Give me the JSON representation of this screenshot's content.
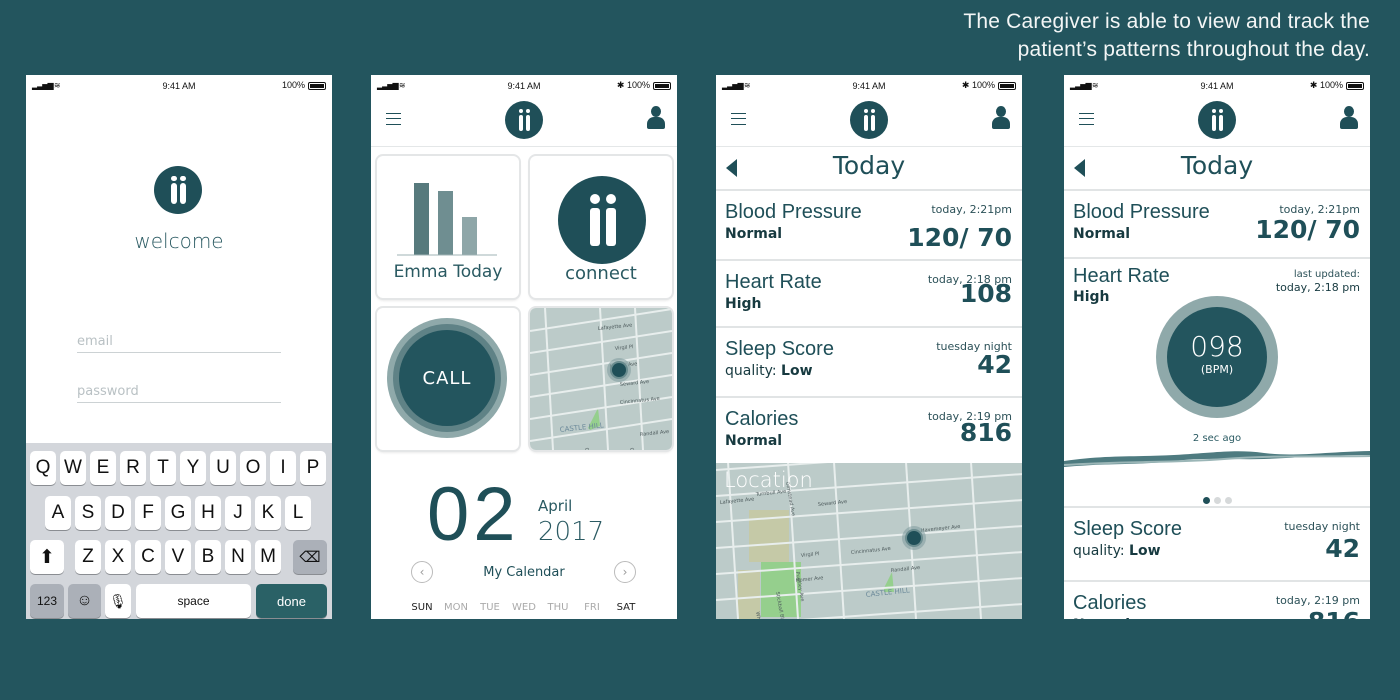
{
  "caption": {
    "line1": "The Caregiver is able to view and track the",
    "line2": "patient’s patterns throughout the day."
  },
  "status": {
    "time": "9:41 AM",
    "battery": "100%"
  },
  "login": {
    "welcome": "welcome",
    "email_placeholder": "email",
    "password_placeholder": "password",
    "keyboard": {
      "row1": [
        "Q",
        "W",
        "E",
        "R",
        "T",
        "Y",
        "U",
        "O",
        "I",
        "P"
      ],
      "row2": [
        "A",
        "S",
        "D",
        "F",
        "G",
        "H",
        "J",
        "K",
        "L"
      ],
      "row3": [
        "Z",
        "X",
        "C",
        "V",
        "B",
        "N",
        "M"
      ],
      "numbers": "123",
      "space": "space",
      "done": "done"
    }
  },
  "home": {
    "tiles": {
      "today": "Emma Today",
      "connect": "connect",
      "call": "CALL"
    },
    "calendar": {
      "day": "02",
      "month": "April",
      "year": "2017",
      "label": "My Calendar",
      "days": [
        "SUN",
        "MON",
        "TUE",
        "WED",
        "THU",
        "FRI",
        "SAT"
      ]
    }
  },
  "map": {
    "labels": [
      "Lafayette Ave",
      "Virgil Pl",
      "Homer Ave",
      "Seward Ave",
      "Cincinnatus Ave",
      "Randall Ave",
      "Olmstead Ave",
      "Castle Hill Ave",
      "CASTLE HILL",
      "Turnbull Ave",
      "Pugsley Ave",
      "Stickball Blvd",
      "White Plains Rd",
      "Havemeyer Ave"
    ],
    "location_label": "Location"
  },
  "today": {
    "title": "Today",
    "metrics": [
      {
        "name": "Blood Pressure",
        "status": "Normal",
        "time": "today, 2:21pm",
        "value": "120/ 70"
      },
      {
        "name": "Heart Rate",
        "status": "High",
        "time": "today, 2:18 pm",
        "value": "108",
        "unit": "(BPM)"
      },
      {
        "name": "Sleep Score",
        "status_prefix": "quality: ",
        "status": "Low",
        "time": "tuesday night",
        "value": "42"
      },
      {
        "name": "Calories",
        "status": "Normal",
        "time": "today, 2:19 pm",
        "value": "816"
      }
    ],
    "live": {
      "last_updated": "last updated:",
      "time": "today, 2:18 pm",
      "bpm": "098",
      "unit": "(BPM)",
      "ago": "2 sec ago",
      "page": 1,
      "pages": 3
    }
  },
  "colors": {
    "background": "#23555e",
    "accent": "#1f4f58",
    "ring": "#8fa9aa"
  }
}
